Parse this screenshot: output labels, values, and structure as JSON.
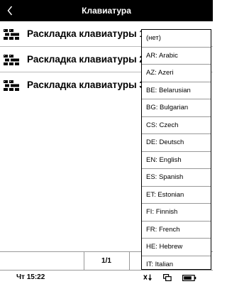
{
  "header": {
    "title": "Клавиатура",
    "back_icon": "chevron-left-icon"
  },
  "layouts": [
    {
      "label": "Раскладка клавиатуры 1",
      "icon": "keyboard-icon"
    },
    {
      "label": "Раскладка клавиатуры 2",
      "icon": "keyboard-icon"
    },
    {
      "label": "Раскладка клавиатуры 3",
      "icon": "keyboard-icon"
    }
  ],
  "dropdown": {
    "options": [
      "(нет)",
      "AR: Arabic",
      "AZ: Azeri",
      "BE: Belarusian",
      "BG: Bulgarian",
      "CS: Czech",
      "DE: Deutsch",
      "EN: English",
      "ES: Spanish",
      "ET: Estonian",
      "FI: Finnish",
      "FR: French",
      "HE: Hebrew",
      "IT: Italian"
    ]
  },
  "footer": {
    "page_indicator": "1/1"
  },
  "status": {
    "time": "Чт 15:22",
    "wifi_icon": "wifi-off-icon",
    "tasks_icon": "task-switch-icon",
    "battery_icon": "battery-icon",
    "battery_level": 0.8
  }
}
